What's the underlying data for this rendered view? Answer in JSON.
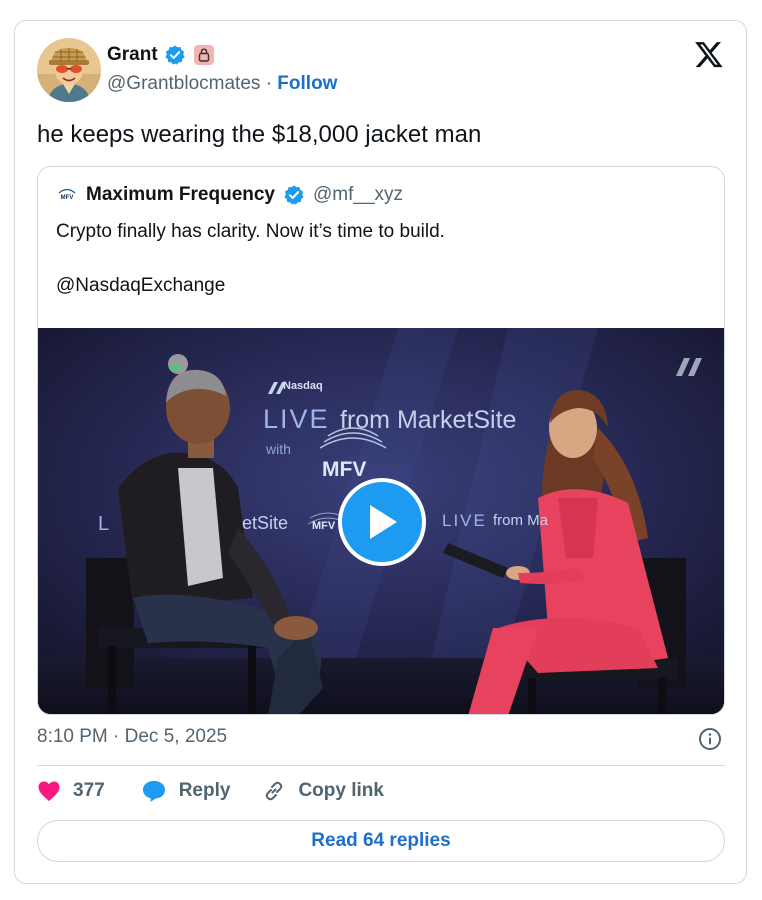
{
  "tweet": {
    "author": {
      "name": "Grant",
      "handle": "@Grantblocmates",
      "separator": "·",
      "follow_label": "Follow"
    },
    "text": "he keeps wearing the $18,000 jacket man",
    "timestamp": "8:10 PM · Dec 5, 2025",
    "likes": "377",
    "reply_label": "Reply",
    "copy_link_label": "Copy link",
    "read_replies_label": "Read 64 replies"
  },
  "quoted": {
    "logo_text": "MFV",
    "name": "Maximum Frequency",
    "handle": "@mf__xyz",
    "text_line1": "Crypto finally has clarity. Now it’s time to build.",
    "text_line2": "@NasdaqExchange"
  },
  "video_overlay": {
    "brand": "Nasdaq",
    "live": "LIVE",
    "from_marketsite": "from MarketSite",
    "with": "with",
    "mfv": "MFV",
    "left_fragment_letter": "L",
    "left_fragment": "etSite",
    "small_mfv": "MFV",
    "right_fragment_live": "LIVE",
    "right_fragment_rest": "from Ma"
  },
  "colors": {
    "accent": "#1d9bf0",
    "link": "#1d70c9",
    "like": "#f91880",
    "muted": "#536471",
    "border": "#cfd9de"
  },
  "icons": {
    "verified": "verified-badge-icon",
    "x_logo": "x-logo-icon",
    "play": "play-icon",
    "info": "info-icon",
    "like": "heart-icon",
    "reply": "reply-bubble-icon",
    "copy_link": "link-icon"
  }
}
